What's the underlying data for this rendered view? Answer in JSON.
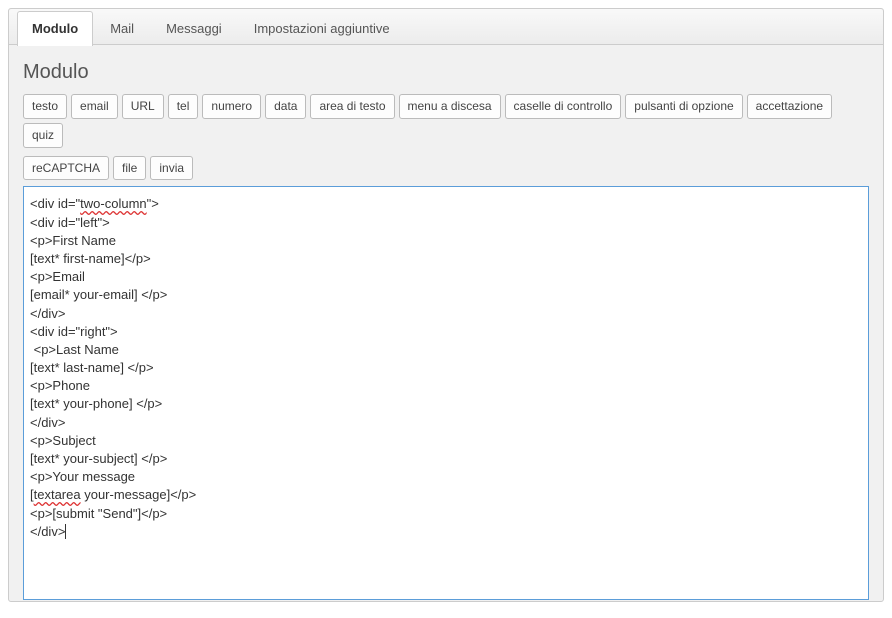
{
  "tabs": [
    {
      "label": "Modulo",
      "active": true
    },
    {
      "label": "Mail",
      "active": false
    },
    {
      "label": "Messaggi",
      "active": false
    },
    {
      "label": "Impostazioni aggiuntive",
      "active": false
    }
  ],
  "section_title": "Modulo",
  "tag_generators_row1": [
    "testo",
    "email",
    "URL",
    "tel",
    "numero",
    "data",
    "area di testo",
    "menu a discesa",
    "caselle di controllo",
    "pulsanti di opzione",
    "accettazione",
    "quiz"
  ],
  "tag_generators_row2": [
    "reCAPTCHA",
    "file",
    "invia"
  ],
  "form_editor_lines": [
    {
      "pre": "<div id=\"",
      "spell": "two-column",
      "post": "\">"
    },
    {
      "pre": "<div id=\"left\">",
      "spell": null,
      "post": ""
    },
    {
      "pre": "<p>First Name",
      "spell": null,
      "post": ""
    },
    {
      "pre": "[text* first-name]</p>",
      "spell": null,
      "post": ""
    },
    {
      "pre": "<p>Email",
      "spell": null,
      "post": ""
    },
    {
      "pre": "[email* your-email] </p>",
      "spell": null,
      "post": ""
    },
    {
      "pre": "</div>",
      "spell": null,
      "post": ""
    },
    {
      "pre": "<div id=\"right\">",
      "spell": null,
      "post": ""
    },
    {
      "pre": " <p>Last Name",
      "spell": null,
      "post": ""
    },
    {
      "pre": "[text* last-name] </p>",
      "spell": null,
      "post": ""
    },
    {
      "pre": "<p>Phone",
      "spell": null,
      "post": ""
    },
    {
      "pre": "[text* your-phone] </p>",
      "spell": null,
      "post": ""
    },
    {
      "pre": "</div>",
      "spell": null,
      "post": ""
    },
    {
      "pre": "<p>Subject",
      "spell": null,
      "post": ""
    },
    {
      "pre": "[text* your-subject] </p>",
      "spell": null,
      "post": ""
    },
    {
      "pre": "<p>Your message",
      "spell": null,
      "post": ""
    },
    {
      "pre": "[",
      "spell": "textarea",
      "post": " your-message]</p>"
    },
    {
      "pre": "<p>[submit \"Send\"]</p>",
      "spell": null,
      "post": ""
    },
    {
      "pre": "</div>",
      "spell": null,
      "post": "",
      "caret_after": true
    }
  ]
}
